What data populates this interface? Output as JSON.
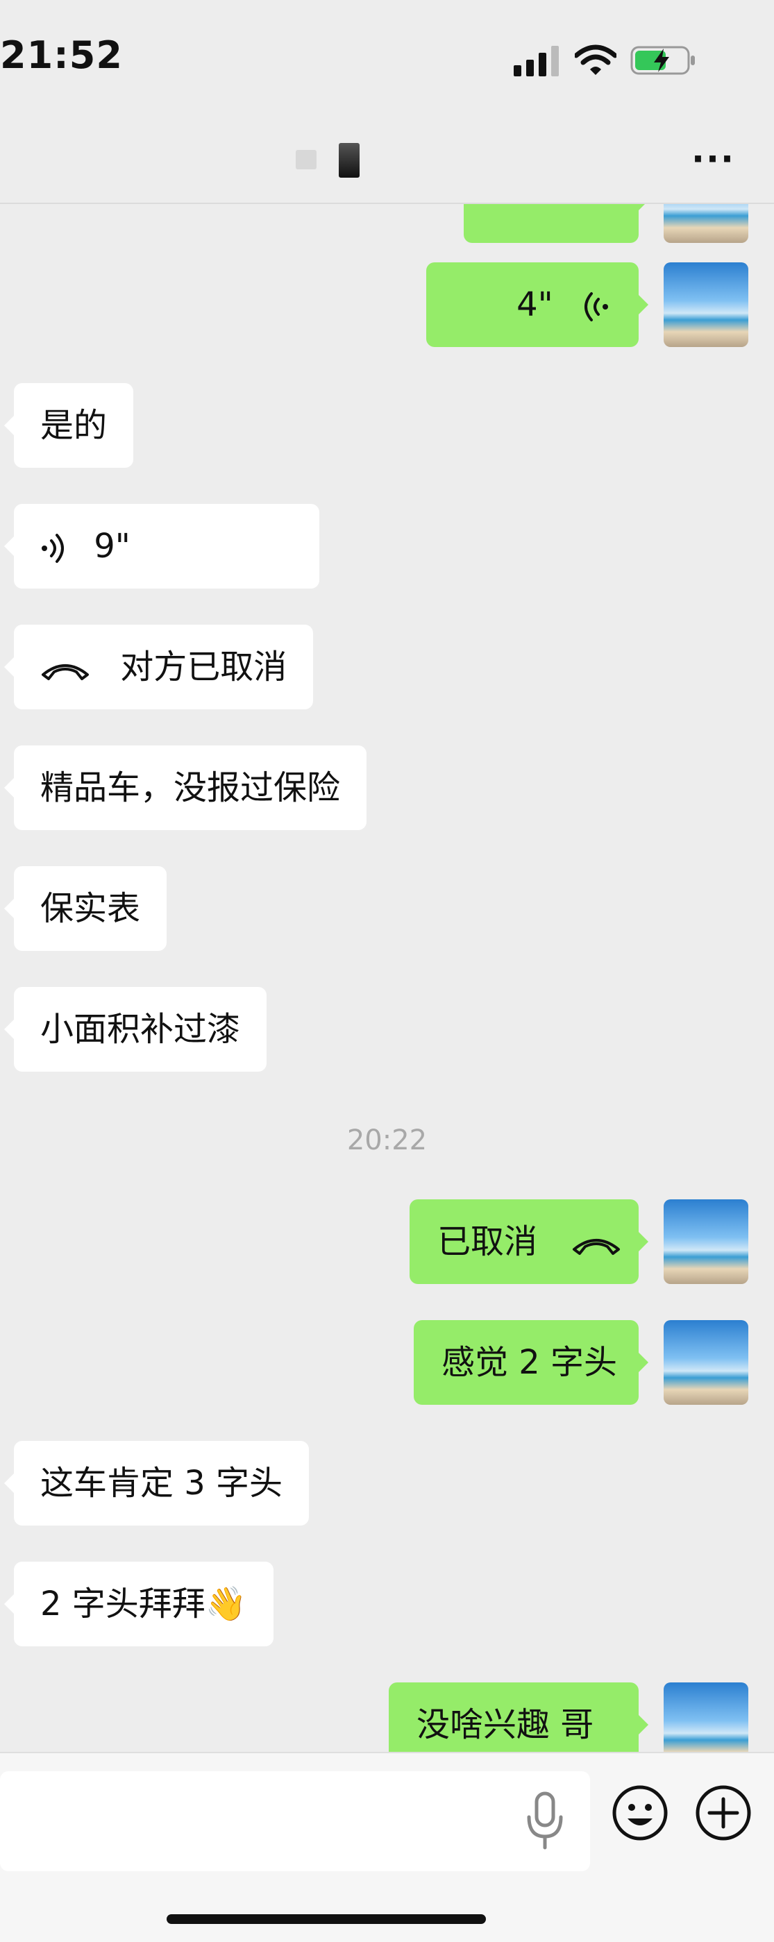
{
  "status": {
    "time": "21:52"
  },
  "header": {
    "title": ""
  },
  "messages": {
    "m1": {
      "duration": "4\""
    },
    "m2": {
      "text": "是的"
    },
    "m3": {
      "duration": "9\""
    },
    "m4": {
      "text": "对方已取消"
    },
    "m5": {
      "text": "精品车，没报过保险"
    },
    "m6": {
      "text": "保实表"
    },
    "m7": {
      "text": "小面积补过漆"
    },
    "ts1": "20:22",
    "m8": {
      "text": "已取消"
    },
    "m9": {
      "text": "感觉 2 字头"
    },
    "m10": {
      "text": "这车肯定 3 字头"
    },
    "m11": {
      "text": "2 字头拜拜👋"
    },
    "m12": {
      "text": "没啥兴趣 哥"
    }
  },
  "input": {
    "placeholder": ""
  },
  "colors": {
    "out_bubble": "#95ec69",
    "in_bubble": "#ffffff",
    "background": "#ededed"
  }
}
